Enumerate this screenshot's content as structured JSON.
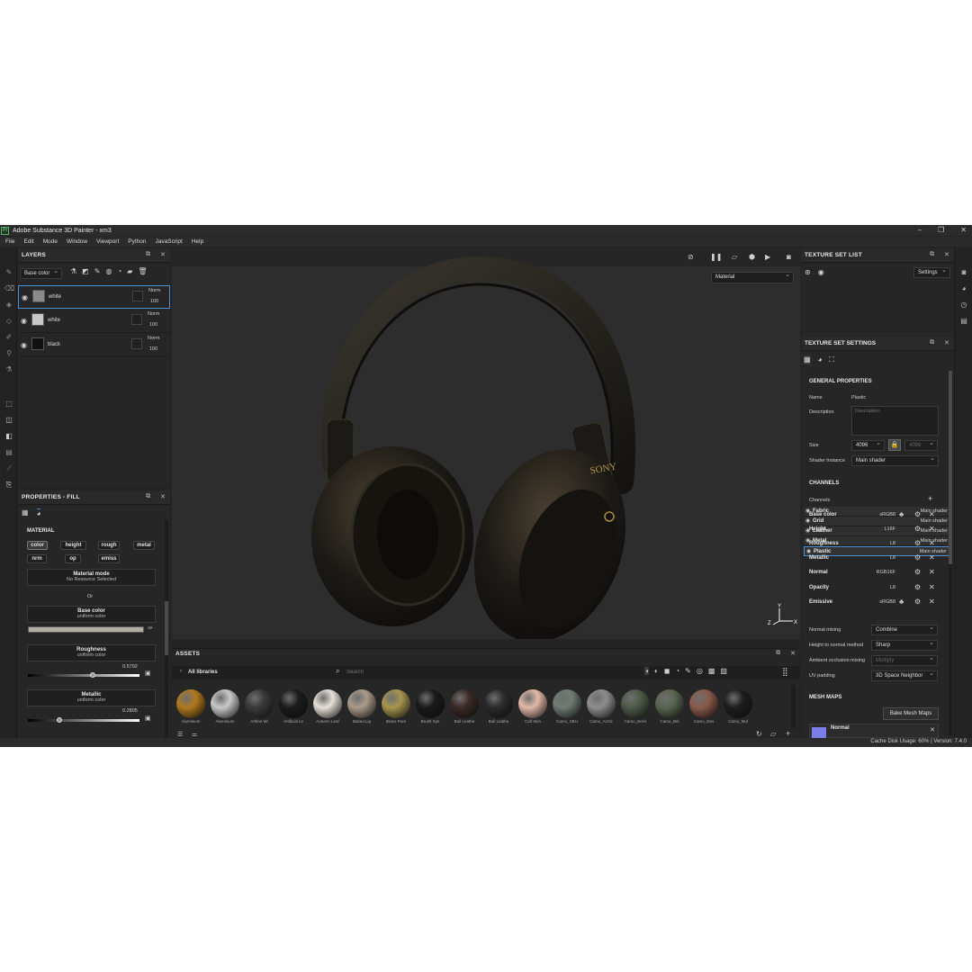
{
  "window": {
    "app_icon": "Pt",
    "title": "Adobe Substance 3D Painter - xm3",
    "minimize": "–",
    "maximize": "❐",
    "close": "✕"
  },
  "menu": [
    "File",
    "Edit",
    "Mode",
    "Window",
    "Viewport",
    "Python",
    "JavaScript",
    "Help"
  ],
  "layers": {
    "title": "LAYERS",
    "channel_select": "Base color",
    "rows": [
      {
        "name": "white",
        "blend": "Norm",
        "opacity": "100",
        "thumb_color": "#8a8a8a"
      },
      {
        "name": "white",
        "blend": "Norm",
        "opacity": "100",
        "thumb_color": "#c8c8c8"
      },
      {
        "name": "black",
        "blend": "Norm",
        "opacity": "100",
        "thumb_color": "#111111"
      }
    ]
  },
  "properties": {
    "title": "PROPERTIES - FILL",
    "material_heading": "MATERIAL",
    "chips": [
      "color",
      "height",
      "rough",
      "metal",
      "nrm",
      "op",
      "emiss"
    ],
    "material_mode": {
      "label": "Material mode",
      "value": "No Resource Selected"
    },
    "or_text": "Or",
    "base_color": {
      "label": "Base color",
      "sub": "uniform color",
      "swatch": "#b3aea4"
    },
    "roughness": {
      "label": "Roughness",
      "sub": "uniform color",
      "value": "0.5792",
      "level": 0.5792
    },
    "metallic": {
      "label": "Metallic",
      "sub": "uniform color",
      "value": "0.2805",
      "level": 0.2805
    }
  },
  "viewport": {
    "mode_select": "Material",
    "logo_text": "SONY",
    "axis_labels": {
      "y": "Y",
      "z": "Z",
      "x": "X"
    }
  },
  "assets": {
    "title": "ASSETS",
    "library": "All libraries",
    "search_placeholder": "Search",
    "items": [
      {
        "label": "Aluminium",
        "color": "#b07a1e"
      },
      {
        "label": "Aluminium",
        "color": "#c9c9c9"
      },
      {
        "label": "Artline Wi",
        "color": "#3a3a3a"
      },
      {
        "label": "Artificial Le",
        "color": "#1c1c1c"
      },
      {
        "label": "Autumn Leaf",
        "color": "#e6e0d8"
      },
      {
        "label": "Baked Lig",
        "color": "#a89a88"
      },
      {
        "label": "Brass Pure",
        "color": "#a7954f"
      },
      {
        "label": "Brush Syn",
        "color": "#1a1a1a"
      },
      {
        "label": "Bull Leathe",
        "color": "#3b2a26"
      },
      {
        "label": "Bull Leathe",
        "color": "#2b2b2b"
      },
      {
        "label": "Calf Skin",
        "color": "#e3b8a8"
      },
      {
        "label": "Camo_SBU",
        "color": "#6f7a72"
      },
      {
        "label": "Camo_Arctic",
        "color": "#8d8d8d"
      },
      {
        "label": "Camo_Boris",
        "color": "#4e5a48"
      },
      {
        "label": "Camo_Brk",
        "color": "#5a6650"
      },
      {
        "label": "Camo_Des",
        "color": "#8a5a4a"
      },
      {
        "label": "Camo_Mul",
        "color": "#1e1e1e"
      }
    ]
  },
  "texture_set_list": {
    "title": "TEXTURE SET LIST",
    "settings_select": "Settings",
    "rows": [
      {
        "name": "Fabric",
        "shader": "Main shader"
      },
      {
        "name": "Grid",
        "shader": "Main shader"
      },
      {
        "name": "Leather",
        "shader": "Main shader"
      },
      {
        "name": "Metal",
        "shader": "Main shader"
      },
      {
        "name": "Plastic",
        "shader": "Main shader"
      }
    ]
  },
  "texture_set_settings": {
    "title": "TEXTURE SET SETTINGS",
    "general_heading": "GENERAL PROPERTIES",
    "name_label": "Name",
    "name_value": "Plastic",
    "description_label": "Description",
    "description_placeholder": "Description",
    "size_label": "Size",
    "size_value": "4096",
    "size_value_2": "4096",
    "shader_instance_label": "Shader Instance",
    "shader_instance_value": "Main shader",
    "channels_heading": "CHANNELS",
    "channels_label": "Channels",
    "channels": [
      {
        "name": "Base color",
        "format": "sRGB8"
      },
      {
        "name": "Height",
        "format": "L16F"
      },
      {
        "name": "Roughness",
        "format": "L8"
      },
      {
        "name": "Metallic",
        "format": "L8"
      },
      {
        "name": "Normal",
        "format": "RGB16F"
      },
      {
        "name": "Opacity",
        "format": "L8"
      },
      {
        "name": "Emissive",
        "format": "sRGB8"
      }
    ],
    "normal_mixing_label": "Normal mixing",
    "normal_mixing_value": "Combine",
    "height_normal_label": "Height to normal method",
    "height_normal_value": "Sharp",
    "ao_mixing_label": "Ambient occlusion mixing",
    "ao_mixing_value": "Multiply",
    "uv_padding_label": "UV padding",
    "uv_padding_value": "3D Space Neighbor",
    "mesh_maps_heading": "MESH MAPS",
    "bake_button": "Bake Mesh Maps",
    "mesh_map_item": "Normal"
  },
  "status": {
    "text": "Cache Disk Usage:    60% | Version: 7.4.0"
  }
}
